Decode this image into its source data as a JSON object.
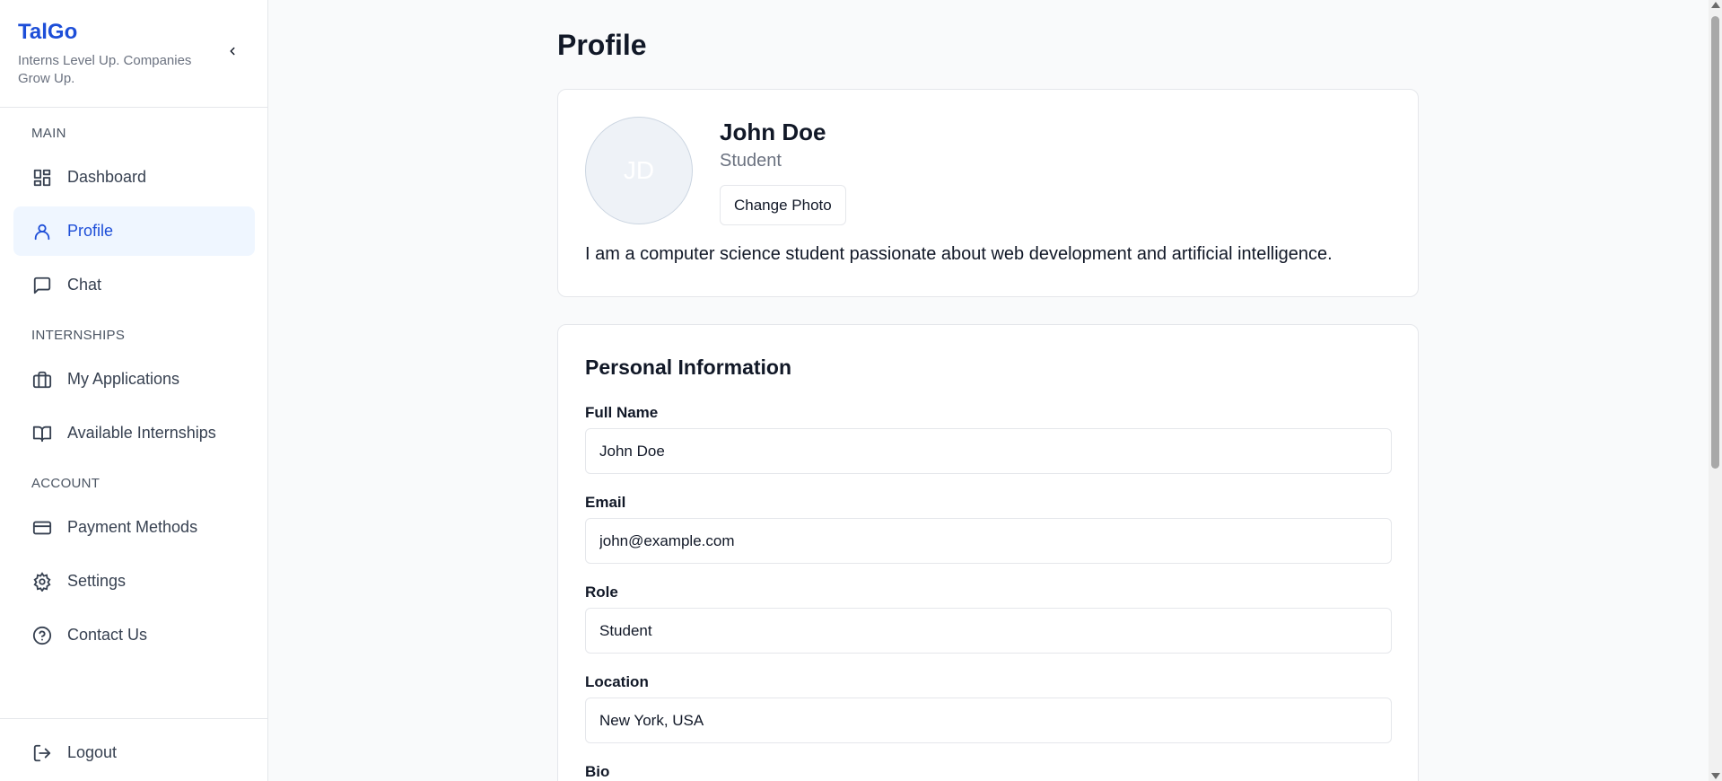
{
  "brand": {
    "title": "TalGo",
    "subtitle": "Interns Level Up. Companies Grow Up."
  },
  "sidebar": {
    "sections": {
      "main": "MAIN",
      "internships": "INTERNSHIPS",
      "account": "ACCOUNT"
    },
    "items": [
      {
        "label": "Dashboard",
        "icon": "dashboard-icon"
      },
      {
        "label": "Profile",
        "icon": "user-icon",
        "active": true
      },
      {
        "label": "Chat",
        "icon": "chat-icon"
      },
      {
        "label": "My Applications",
        "icon": "briefcase-icon"
      },
      {
        "label": "Available Internships",
        "icon": "book-icon"
      },
      {
        "label": "Payment Methods",
        "icon": "credit-card-icon"
      },
      {
        "label": "Settings",
        "icon": "gear-icon"
      },
      {
        "label": "Contact Us",
        "icon": "help-circle-icon"
      }
    ],
    "logout": "Logout"
  },
  "page": {
    "title": "Profile"
  },
  "profile": {
    "initials": "JD",
    "name": "John Doe",
    "role": "Student",
    "change_photo": "Change Photo",
    "bio": "I am a computer science student passionate about web development and artificial intelligence."
  },
  "personal": {
    "title": "Personal Information",
    "fields": {
      "full_name": {
        "label": "Full Name",
        "value": "John Doe"
      },
      "email": {
        "label": "Email",
        "value": "john@example.com"
      },
      "role": {
        "label": "Role",
        "value": "Student"
      },
      "location": {
        "label": "Location",
        "value": "New York, USA"
      },
      "bio": {
        "label": "Bio"
      }
    }
  },
  "colors": {
    "accent": "#1d4ed8",
    "active_bg": "#eff6ff",
    "page_bg": "#f9fafb",
    "border": "#e5e7eb"
  }
}
